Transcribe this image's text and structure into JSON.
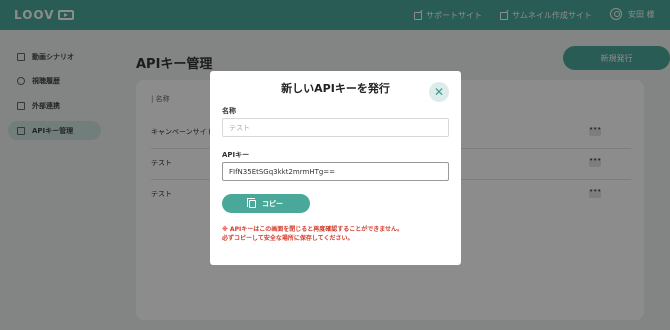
{
  "header": {
    "logo": "LOOV",
    "links": [
      "サポートサイト",
      "サムネイル作成サイト"
    ],
    "user": "安田 様"
  },
  "sidebar": {
    "items": [
      {
        "label": "動画シナリオ"
      },
      {
        "label": "視聴履歴"
      },
      {
        "label": "外部連携"
      },
      {
        "label": "APIキー管理"
      }
    ]
  },
  "main": {
    "title": "APIキー管理",
    "new_button": "新規発行",
    "column_header": "| 名称",
    "rows": [
      {
        "name": "キャンペーンサイト"
      },
      {
        "name": "テスト"
      },
      {
        "name": "テスト"
      }
    ],
    "more_glyph": "•••"
  },
  "modal": {
    "title": "新しいAPIキーを発行",
    "close_glyph": "✕",
    "name_label": "名称",
    "name_placeholder": "テスト",
    "apikey_label": "APIキー",
    "apikey_value": "FIfN35EtSGq3kkt2mrmHTg==",
    "copy_button": "コピー",
    "warning_line1": "※ APIキーはこの画面を閉じると再度確認することができません。",
    "warning_line2": "必ずコピーして安全な場所に保存してください。"
  },
  "colors": {
    "brand": "#4aa89a",
    "warning": "#d23a2a"
  },
  "icons": {
    "header_link": "external-link-icon",
    "user": "user-circle-icon",
    "close": "close-icon",
    "copy": "copy-icon"
  }
}
